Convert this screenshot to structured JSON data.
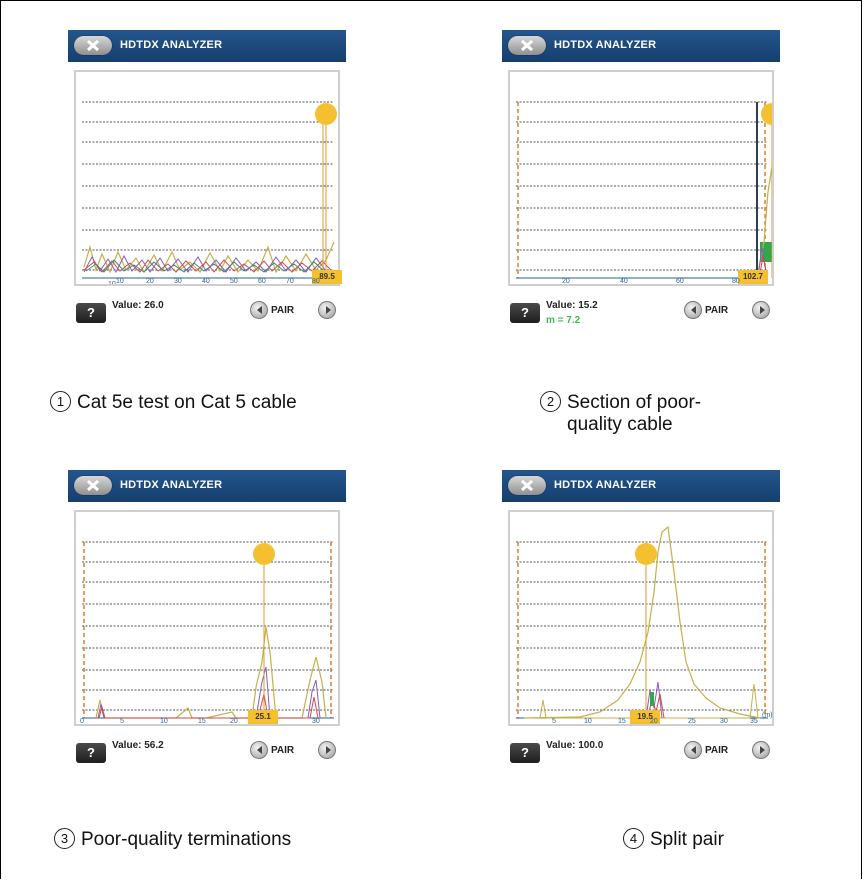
{
  "panels": [
    {
      "title": "HDTDX ANALYZER",
      "value": "Value: 26.0",
      "marker": "89.5",
      "pair": "PAIR",
      "xticks": [
        "10",
        "20",
        "30",
        "40",
        "50",
        "60",
        "70",
        "80"
      ],
      "unit": "",
      "extra": ""
    },
    {
      "title": "HDTDX ANALYZER",
      "value": "Value: 15.2",
      "marker": "102.7",
      "pair": "PAIR",
      "xticks": [
        "20",
        "40",
        "60",
        "80"
      ],
      "unit": "",
      "extra": "m = 7.2"
    },
    {
      "title": "HDTDX ANALYZER",
      "value": "Value: 56.2",
      "marker": "25.1",
      "pair": "PAIR",
      "xticks": [
        "0",
        "5",
        "10",
        "15",
        "20",
        "30"
      ],
      "unit": "(m)",
      "extra": ""
    },
    {
      "title": "HDTDX ANALYZER",
      "value": "Value: 100.0",
      "marker": "19.5",
      "pair": "PAIR",
      "xticks": [
        "5",
        "10",
        "15",
        "20",
        "25",
        "30",
        "35"
      ],
      "unit": "(m)",
      "extra": ""
    }
  ],
  "captions": [
    {
      "num": "1",
      "text": "Cat 5e test on Cat 5 cable"
    },
    {
      "num": "2",
      "line1": "Section of poor-",
      "line2": "quality cable"
    },
    {
      "num": "3",
      "text": "Poor-quality terminations"
    },
    {
      "num": "4",
      "text": "Split pair"
    }
  ],
  "help_label": "?",
  "colors": {
    "titlebar": "#1f4f85",
    "marker": "#f5c030",
    "cursor": "#e07a2a",
    "fault_zone": "#2fa84a"
  }
}
